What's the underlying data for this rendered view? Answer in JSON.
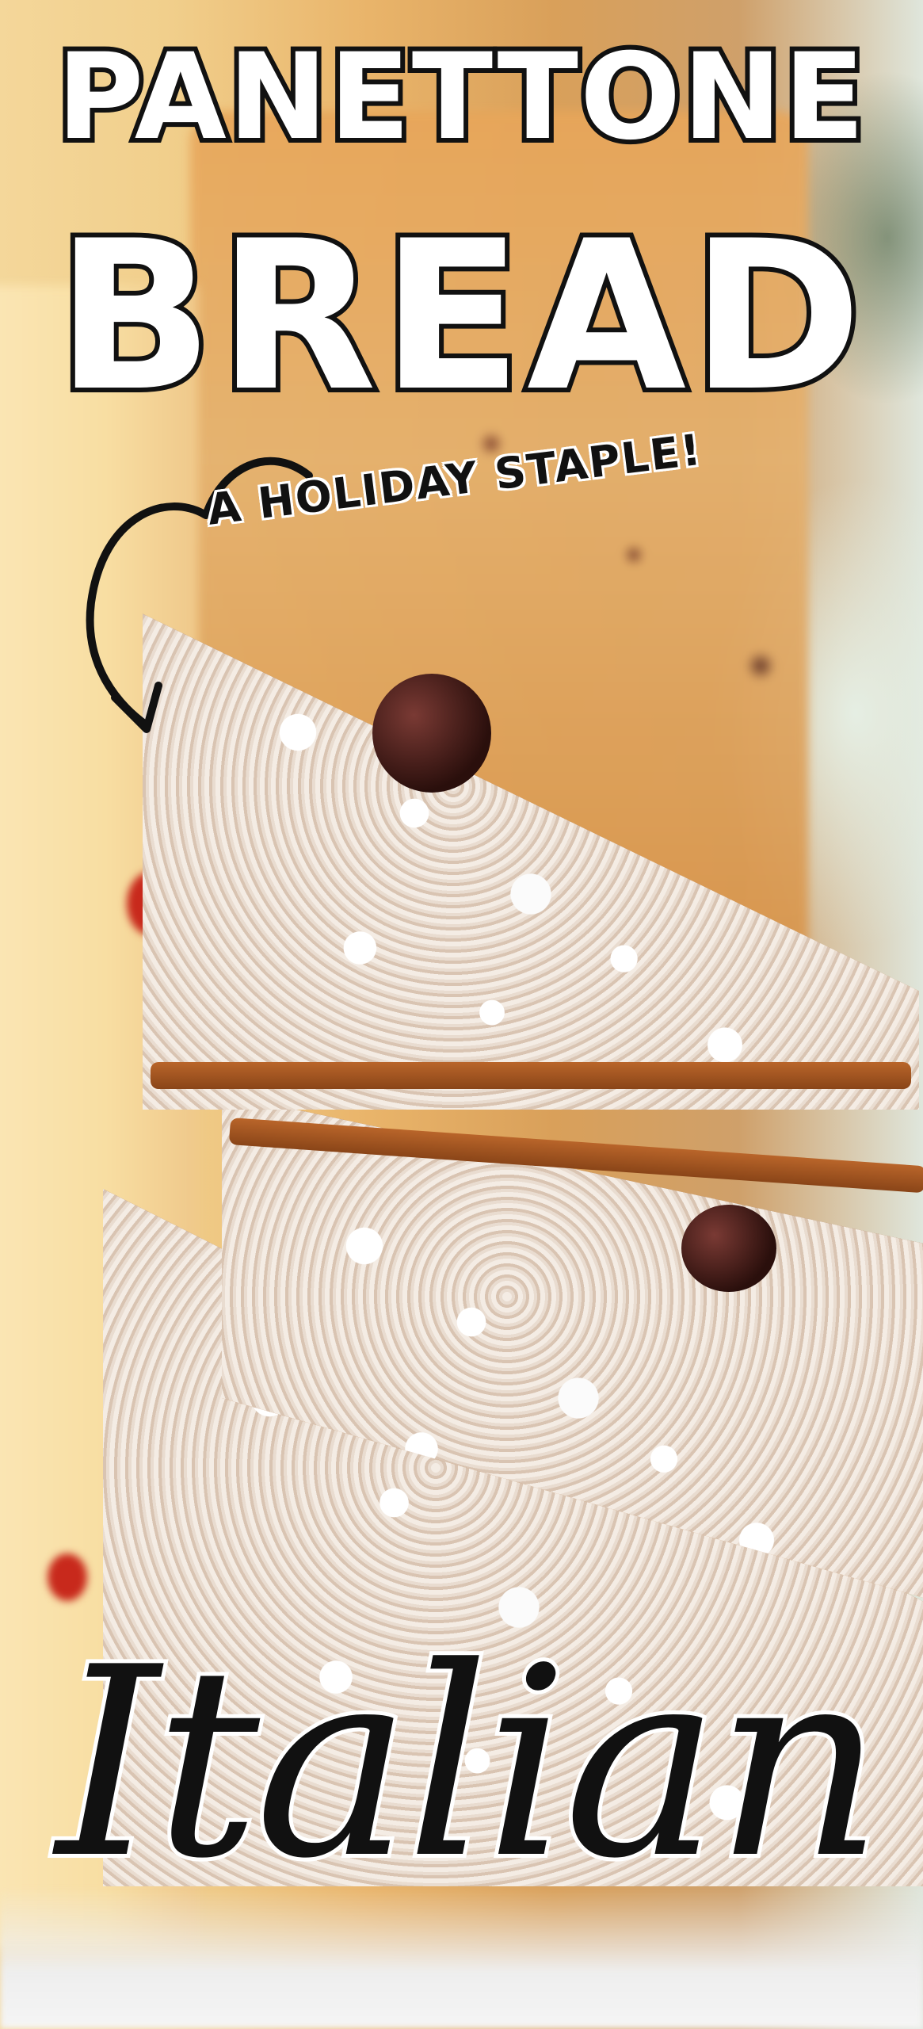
{
  "headline": {
    "line1": "PANETTONE",
    "line2": "BREAD"
  },
  "tagline": "A HOLIDAY STAPLE!",
  "script_word": "Italian",
  "colors": {
    "title_fill": "#ffffff",
    "title_outline": "#111111",
    "script_fill": "#111111",
    "script_outline": "#ffffff"
  },
  "icons": [
    "curved-arrow-icon"
  ]
}
